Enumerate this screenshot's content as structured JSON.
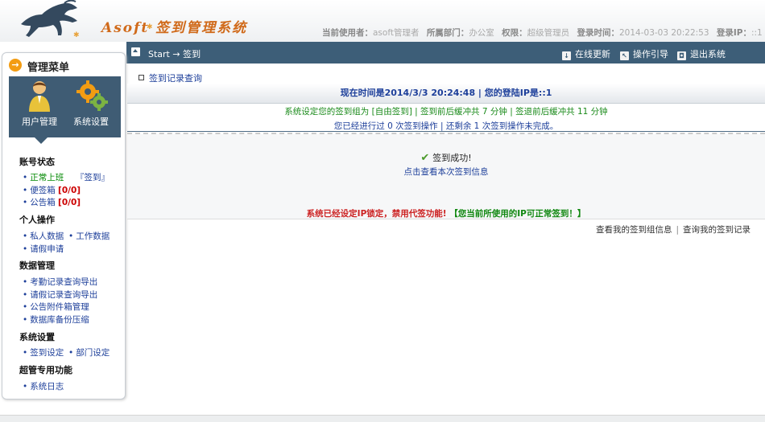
{
  "header": {
    "logo_text": "Asoft 签到管理系统",
    "user_info": [
      {
        "label": "当前使用者：",
        "value": "asoft管理者"
      },
      {
        "label": "所属部门：",
        "value": "办公室"
      },
      {
        "label": "权限：",
        "value": "超级管理员"
      },
      {
        "label": "登录时间：",
        "value": "2014-03-03 20:22:53"
      },
      {
        "label": "登录IP：",
        "value": "::1"
      }
    ]
  },
  "navbar": {
    "breadcrumb": "Start → 签到",
    "actions": [
      {
        "label": "在线更新",
        "icon": "download-icon"
      },
      {
        "label": "操作引导",
        "icon": "pointer-icon"
      },
      {
        "label": "退出系统",
        "icon": "exit-icon"
      }
    ]
  },
  "sidebar": {
    "title": "管理菜单",
    "tiles": [
      {
        "label": "用户管理",
        "icon": "user-icon"
      },
      {
        "label": "系统设置",
        "icon": "gears-icon"
      }
    ],
    "sections": [
      {
        "title": "账号状态"
      },
      {
        "title": "个人操作"
      },
      {
        "title": "数据管理"
      },
      {
        "title": "系统设置"
      },
      {
        "title": "超管专用功能"
      }
    ],
    "status": {
      "work_label": "正常上班",
      "sign_label": "『签到』",
      "note_label": "便签箱",
      "note_count": "[0/0]",
      "notice_label": "公告箱",
      "notice_count": "[0/0]"
    },
    "personal": [
      "私人数据",
      "工作数据",
      "请假申请"
    ],
    "data_mgmt": [
      "考勤记录查询导出",
      "请假记录查询导出",
      "公告附件箱管理",
      "数据库备份压缩"
    ],
    "settings": [
      "签到设定",
      "部门设定"
    ],
    "admin": [
      "系统日志"
    ]
  },
  "main": {
    "title": "签到记录查询",
    "time_bar": "现在时间是2014/3/3 20:24:48 |   您的登陆IP是::1",
    "info_line1": "系统设定您的签到组为 [自由签到] | 签到前后缓冲共  7 分钟  | 签退前后缓冲共  11 分钟",
    "info_line2": "您已经进行过  0 次签到操作  | 还剩余  1 次签到操作未完成。",
    "success": "签到成功!",
    "success_link": "点击查看本次签到信息",
    "lock_red": "系统已经设定IP锁定，禁用代签功能!",
    "lock_green": "【您当前所使用的IP可正常签到！】",
    "bottom_links": [
      "查看我的签到组信息",
      "查询我的签到记录"
    ]
  },
  "colors": {
    "navbar": "#3d5e78",
    "accent_orange": "#f39c12",
    "link_blue": "#1d3f9a",
    "alert_red": "#cc2222",
    "ok_green": "#118811"
  }
}
